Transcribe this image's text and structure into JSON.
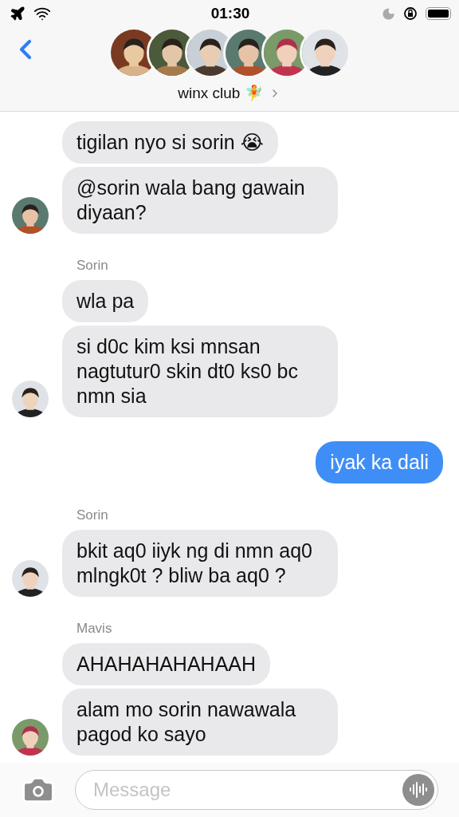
{
  "status_bar": {
    "time": "01:30"
  },
  "header": {
    "title": "winx club 🧚"
  },
  "groups": [
    {
      "kind": "incoming",
      "messages": [
        "tigilan nyo si sorin 😭",
        "@sorin wala bang gawain diyaan?"
      ]
    },
    {
      "kind": "incoming",
      "sender": "Sorin",
      "messages": [
        "wla pa",
        "si d0c kim ksi mnsan nagtutur0 skin dt0 ks0 bc nmn sia"
      ]
    },
    {
      "kind": "outgoing",
      "messages": [
        "iyak ka dali"
      ]
    },
    {
      "kind": "incoming",
      "sender": "Sorin",
      "messages": [
        "bkit aq0 iiyk ng di nmn aq0 mlngk0t ? bliw ba aq0 ?"
      ]
    },
    {
      "kind": "incoming",
      "sender": "Mavis",
      "messages": [
        "AHAHAHAHAHAAH",
        "alam mo sorin nawawala pagod ko sayo"
      ]
    }
  ],
  "composer": {
    "placeholder": "Message"
  }
}
